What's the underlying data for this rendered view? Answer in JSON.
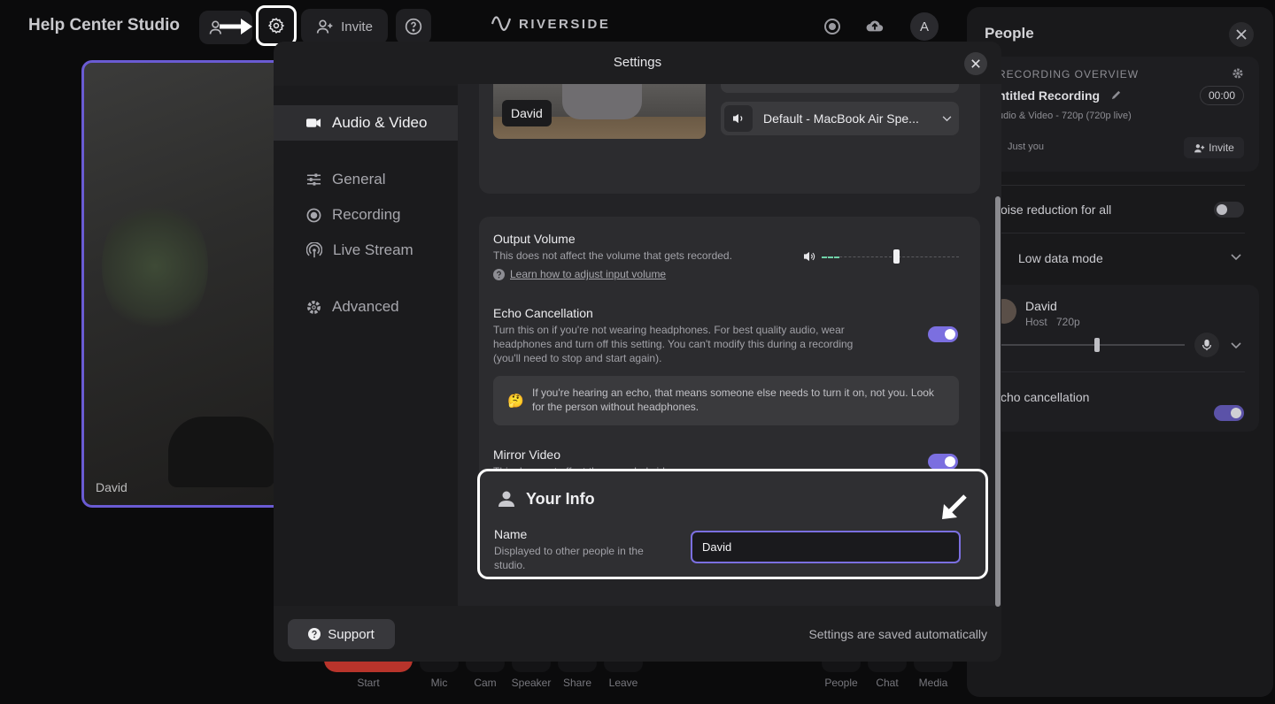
{
  "topbar": {
    "studio_title": "Help Center Studio",
    "invite_label": "Invite",
    "brand": "RIVERSIDE",
    "avatar_letter": "A"
  },
  "video_tile": {
    "name": "David"
  },
  "people_panel": {
    "title": "People",
    "overview_heading": "RECORDING OVERVIEW",
    "recording_title": "ntitled Recording",
    "timer": "00:00",
    "recording_meta": "udio & Video - 720p (720p live)",
    "participants": "Just you",
    "invite_label": "Invite",
    "noise_reduction_label": "oise reduction for all",
    "noise_reduction_on": false,
    "low_data_label": "Low data mode",
    "person": {
      "name": "David",
      "role": "Host",
      "quality": "720p"
    },
    "echo_label": "cho cancellation",
    "echo_on": true
  },
  "bottom_controls": {
    "items": [
      "Start",
      "Mic",
      "Cam",
      "Speaker",
      "Share",
      "Leave"
    ],
    "right_items": [
      "People",
      "Chat",
      "Media"
    ]
  },
  "settings": {
    "title": "Settings",
    "nav": [
      {
        "label": "Audio & Video",
        "icon": "camera-icon",
        "active": true
      },
      {
        "label": "General",
        "icon": "sliders-icon",
        "active": false
      },
      {
        "label": "Recording",
        "icon": "record-icon",
        "active": false
      },
      {
        "label": "Live Stream",
        "icon": "broadcast-icon",
        "active": false
      },
      {
        "label": "Advanced",
        "icon": "gear-icon",
        "active": false
      }
    ],
    "preview_name": "David",
    "speaker_select": "Default - MacBook Air Spe...",
    "output_volume": {
      "title": "Output Volume",
      "description": "This does not affect the volume that gets recorded.",
      "help_link": "Learn how to adjust input volume",
      "level": 0.55
    },
    "echo": {
      "title": "Echo Cancellation",
      "description": "Turn this on if you're not wearing headphones. For best quality audio, wear headphones and turn off this setting. You can't modify this during a recording (you'll need to stop and start again).",
      "on": true,
      "note_emoji": "🤔",
      "note": "If you're hearing an echo, that means someone else needs to turn it on, not you. Look for the person without headphones."
    },
    "mirror": {
      "title": "Mirror Video",
      "description": "This does not affect the recorded video.",
      "on": true
    },
    "your_info": {
      "title": "Your Info",
      "name_label": "Name",
      "name_description": "Displayed to other people in the studio.",
      "name_value": "David"
    },
    "support_label": "Support",
    "saved_note": "Settings are saved automatically"
  },
  "colors": {
    "accent": "#7b6fe0",
    "toggle_on": "#7b6fe0",
    "record": "#c0392b"
  }
}
